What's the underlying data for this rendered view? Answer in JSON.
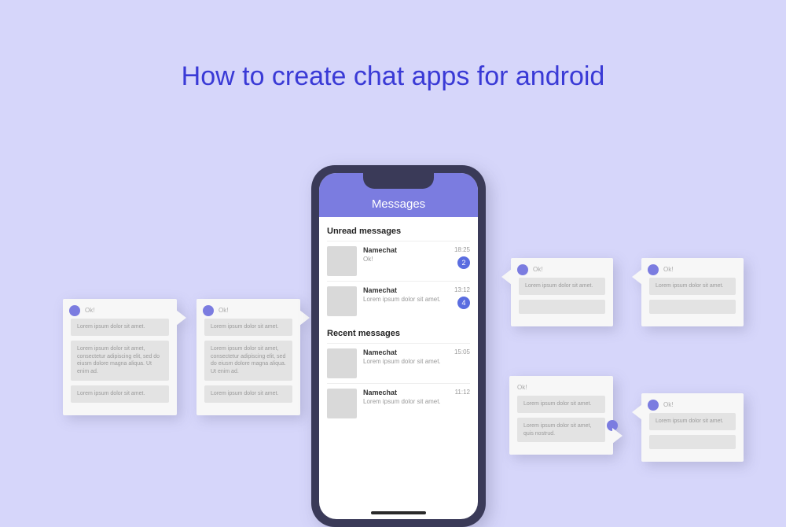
{
  "title": "How to create chat apps for android",
  "phone": {
    "header": "Messages",
    "sections": [
      {
        "heading": "Unread messages",
        "rows": [
          {
            "name": "Namechat",
            "preview": "Ok!",
            "time": "18:25",
            "badge": "2"
          },
          {
            "name": "Namechat",
            "preview": "Lorem ipsum dolor sit amet.",
            "time": "13:12",
            "badge": "4"
          }
        ]
      },
      {
        "heading": "Recent messages",
        "rows": [
          {
            "name": "Namechat",
            "preview": "Lorem ipsum dolor sit amet.",
            "time": "15:05",
            "badge": null
          },
          {
            "name": "Namechat",
            "preview": "Lorem ipsum dolor sit amet.",
            "time": "11:12",
            "badge": null
          }
        ]
      }
    ]
  },
  "placeholder": {
    "ok": "Ok!",
    "short": "Lorem ipsum dolor sit amet.",
    "medium": "Lorem ipsum dolor sit amet, quis nostrud.",
    "long": "Lorem ipsum dolor sit amet, consectetur adipiscing elit, sed do eiusm dolore magna aliqua. Ut enim ad."
  }
}
